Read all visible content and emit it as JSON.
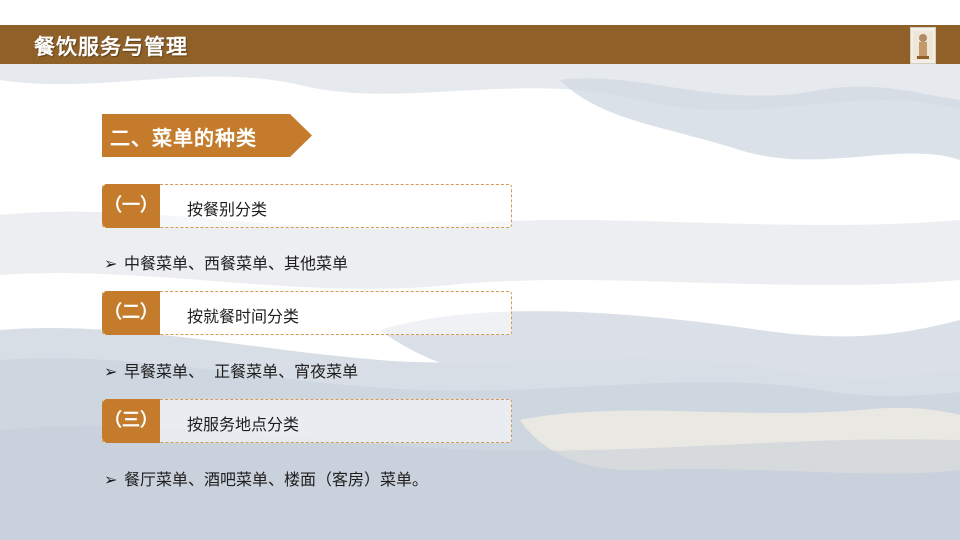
{
  "header": {
    "title": "餐饮服务与管理"
  },
  "section": {
    "title": "二、菜单的种类"
  },
  "categories": [
    {
      "number": "（一）",
      "label": "按餐别分类",
      "detail": "中餐菜单、西餐菜单、其他菜单"
    },
    {
      "number": "（二）",
      "label": "按就餐时间分类",
      "detail": "早餐菜单、  正餐菜单、宵夜菜单"
    },
    {
      "number": "（三）",
      "label": "按服务地点分类",
      "detail": "餐厅菜单、酒吧菜单、楼面（客房）菜单。"
    }
  ],
  "colors": {
    "header_bar": "#8f6128",
    "accent": "#c47c2c",
    "dashed_border": "#d39a56"
  },
  "icons": {
    "bullet": "arrow-bullet-icon"
  }
}
